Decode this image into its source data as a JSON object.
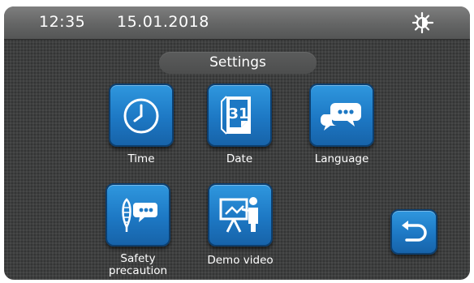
{
  "status_bar": {
    "time": "12:35",
    "date": "15.01.2018",
    "brightness_icon": "sun-brightness-icon"
  },
  "title": "Settings",
  "tiles": [
    {
      "label": "Time",
      "icon": "clock-icon"
    },
    {
      "label": "Date",
      "icon": "calendar-icon"
    },
    {
      "label": "Language",
      "icon": "speech-bubbles-icon"
    },
    {
      "label": "Safety precaution",
      "icon": "safety-icon"
    },
    {
      "label": "Demo video",
      "icon": "presentation-icon"
    }
  ],
  "back_button": {
    "icon": "back-arrow-icon"
  },
  "date_icon_day": "31",
  "colors": {
    "background": "#3e3f3f",
    "status_bar": "#646565",
    "tile_blue": "#1d78c4",
    "text": "#ffffff"
  }
}
